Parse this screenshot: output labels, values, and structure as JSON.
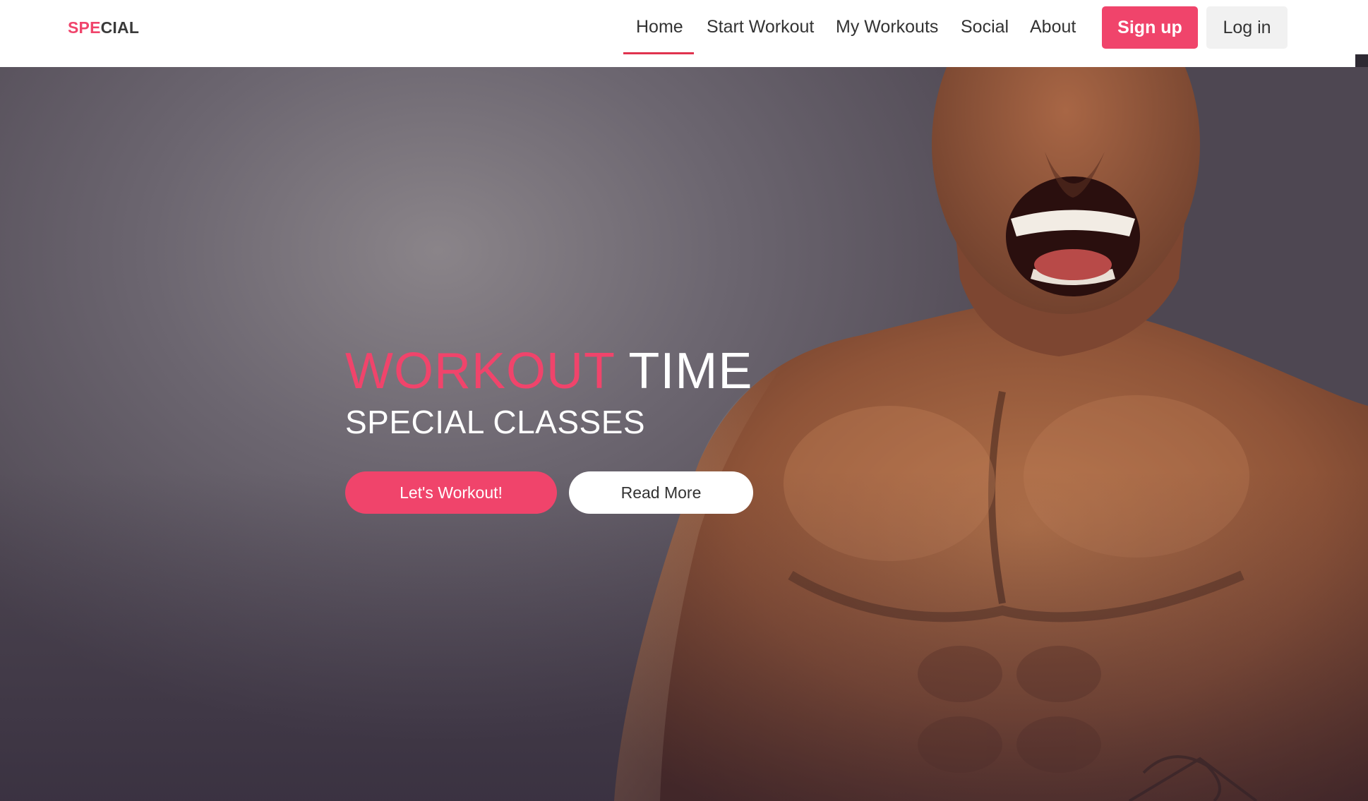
{
  "navbar": {
    "brand_accent": "SPE",
    "brand_rest": "CIAL",
    "links": [
      "Home",
      "Start Workout",
      "My Workouts",
      "Social",
      "About"
    ],
    "active_link": "Home",
    "signup_label": "Sign up",
    "login_label": "Log in"
  },
  "hero": {
    "title_accent": "WORKOUT",
    "title_rest": "TIME",
    "subtitle": "SPECIAL CLASSES",
    "primary_button": "Let's Workout!",
    "secondary_button": "Read More"
  },
  "colors": {
    "accent": "#f0446b",
    "nav_text": "#333333",
    "login_bg": "#f1f1f1"
  }
}
